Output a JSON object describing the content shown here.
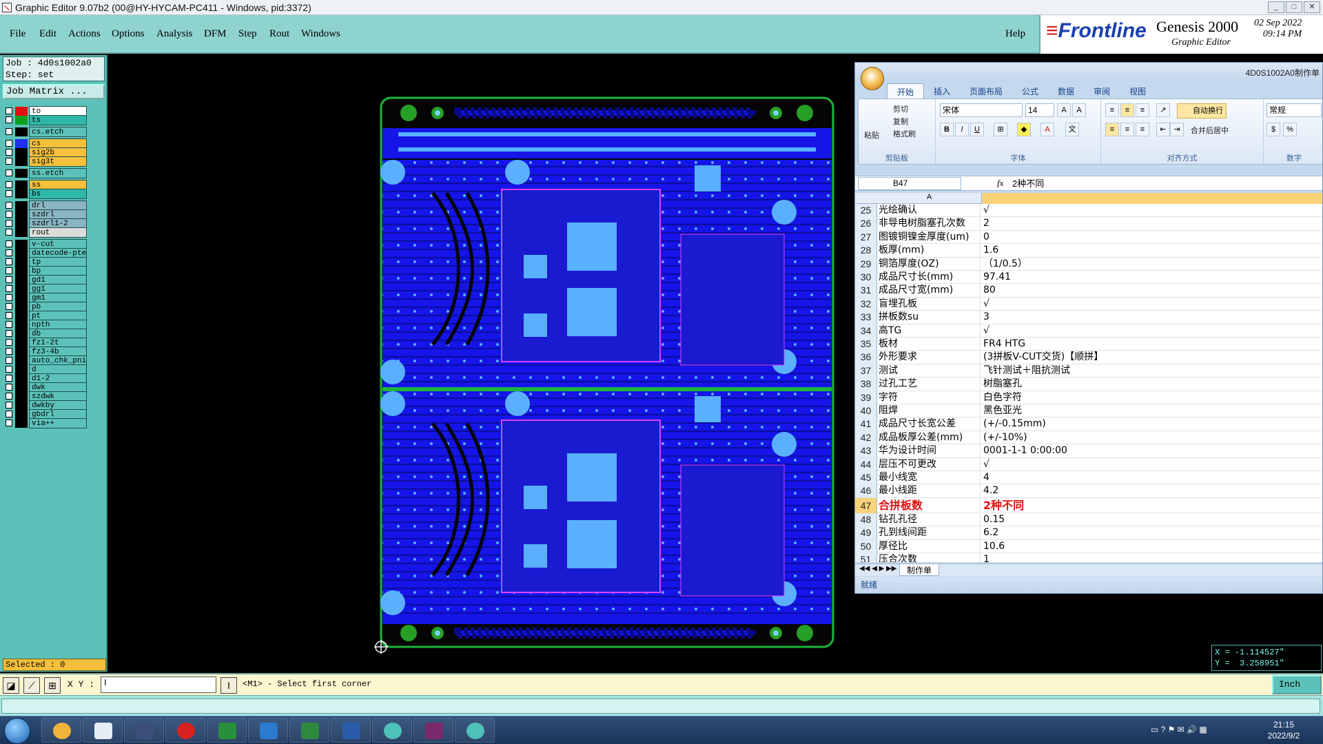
{
  "window": {
    "title": "Graphic Editor 9.07b2 (00@HY-HYCAM-PC411 - Windows, pid:3372)"
  },
  "menu": [
    "File",
    "Edit",
    "Actions",
    "Options",
    "Analysis",
    "DFM",
    "Step",
    "Rout",
    "Windows"
  ],
  "help_label": "Help",
  "brand": {
    "logo": "Frontline",
    "product": "Genesis 2000",
    "subtitle": "Graphic Editor",
    "date": "02 Sep 2022",
    "time": "09:14 PM"
  },
  "job": {
    "job_line": "Job : 4d0s1002a0",
    "step_line": "Step: set",
    "matrix_label": "Job Matrix ..."
  },
  "layers": [
    {
      "name": "to",
      "swatch": "#e41010",
      "bg": "#ffffff"
    },
    {
      "name": "ts",
      "swatch": "#10a020",
      "bg": "#2fb7a8"
    },
    {
      "name": "cs.etch",
      "swatch": "#000000",
      "bg": "#5cc2b9"
    },
    {
      "name": "cs",
      "swatch": "#2030f0",
      "bg": "#f6c03c"
    },
    {
      "name": "sig2b",
      "swatch": "#000000",
      "bg": "#f6c03c"
    },
    {
      "name": "sig3t",
      "swatch": "#000000",
      "bg": "#f6c03c"
    },
    {
      "name": "ss.etch",
      "swatch": "#000000",
      "bg": "#5cc2b9"
    },
    {
      "name": "ss",
      "swatch": "#000000",
      "bg": "#f6c03c"
    },
    {
      "name": "bs",
      "swatch": "#000000",
      "bg": "#2fb7a8"
    },
    {
      "name": "drl",
      "swatch": "#000000",
      "bg": "#8ab5c2"
    },
    {
      "name": "szdrl",
      "swatch": "#000000",
      "bg": "#8ab5c2"
    },
    {
      "name": "szdrl1-2",
      "swatch": "#000000",
      "bg": "#8ab5c2"
    },
    {
      "name": "rout",
      "swatch": "#000000",
      "bg": "#dcdcdc"
    },
    {
      "name": "v-cut",
      "swatch": "#000000",
      "bg": "#5cc2b9"
    },
    {
      "name": "datecode-pte",
      "swatch": "#000000",
      "bg": "#5cc2b9"
    },
    {
      "name": "tp",
      "swatch": "#000000",
      "bg": "#5cc2b9"
    },
    {
      "name": "bp",
      "swatch": "#000000",
      "bg": "#5cc2b9"
    },
    {
      "name": "gd1",
      "swatch": "#000000",
      "bg": "#5cc2b9"
    },
    {
      "name": "gg1",
      "swatch": "#000000",
      "bg": "#5cc2b9"
    },
    {
      "name": "gm1",
      "swatch": "#000000",
      "bg": "#5cc2b9"
    },
    {
      "name": "pb",
      "swatch": "#000000",
      "bg": "#5cc2b9"
    },
    {
      "name": "pt",
      "swatch": "#000000",
      "bg": "#5cc2b9"
    },
    {
      "name": "npth",
      "swatch": "#000000",
      "bg": "#5cc2b9"
    },
    {
      "name": "db",
      "swatch": "#000000",
      "bg": "#5cc2b9"
    },
    {
      "name": "fz1-2t",
      "swatch": "#000000",
      "bg": "#5cc2b9"
    },
    {
      "name": "fz3-4b",
      "swatch": "#000000",
      "bg": "#5cc2b9"
    },
    {
      "name": "auto_chk_pni",
      "swatch": "#000000",
      "bg": "#5cc2b9"
    },
    {
      "name": "d",
      "swatch": "#000000",
      "bg": "#5cc2b9"
    },
    {
      "name": "d1-2",
      "swatch": "#000000",
      "bg": "#5cc2b9"
    },
    {
      "name": "dwk",
      "swatch": "#000000",
      "bg": "#5cc2b9"
    },
    {
      "name": "szdwk",
      "swatch": "#000000",
      "bg": "#5cc2b9"
    },
    {
      "name": "dwkby",
      "swatch": "#000000",
      "bg": "#5cc2b9"
    },
    {
      "name": "gbdrl",
      "swatch": "#000000",
      "bg": "#5cc2b9"
    },
    {
      "name": "via++",
      "swatch": "#000000",
      "bg": "#5cc2b9"
    }
  ],
  "selected": "Selected : 0",
  "status": {
    "xy_label": "X Y :",
    "prompt": "<M1> - Select first corner",
    "units": "Inch",
    "x": "X = -1.114527\"",
    "y": "Y =  3.258951\""
  },
  "excel": {
    "window_title": "4D0S1002A0制作单",
    "tabs": [
      "开始",
      "插入",
      "页面布局",
      "公式",
      "数据",
      "审阅",
      "视图"
    ],
    "clipboard": {
      "paste": "粘贴",
      "cut": "剪切",
      "copy": "复制",
      "format": "格式刷",
      "group": "剪贴板"
    },
    "font": {
      "name": "宋体",
      "size": "14",
      "group": "字体"
    },
    "align": {
      "wrap": "自动换行",
      "merge": "合并后居中",
      "group": "对齐方式"
    },
    "number": {
      "format": "常规",
      "group": "数字"
    },
    "namebox": "B47",
    "formula": "2种不同",
    "col_a": "A",
    "rows": [
      {
        "n": "25",
        "a": "光绘确认",
        "b": "√"
      },
      {
        "n": "26",
        "a": "非导电树脂塞孔次数",
        "b": "2"
      },
      {
        "n": "27",
        "a": "图镀铜镍金厚度(um)",
        "b": "0"
      },
      {
        "n": "28",
        "a": "板厚(mm)",
        "b": "1.6"
      },
      {
        "n": "29",
        "a": "铜箔厚度(OZ)",
        "b": "（1/0.5）"
      },
      {
        "n": "30",
        "a": "成品尺寸长(mm)",
        "b": "97.41"
      },
      {
        "n": "31",
        "a": "成品尺寸宽(mm)",
        "b": "80"
      },
      {
        "n": "32",
        "a": "盲埋孔板",
        "b": "√"
      },
      {
        "n": "33",
        "a": "拼板数su",
        "b": "3"
      },
      {
        "n": "34",
        "a": "高TG",
        "b": "√"
      },
      {
        "n": "35",
        "a": "板材",
        "b": "FR4 HTG"
      },
      {
        "n": "36",
        "a": "外形要求",
        "b": "(3拼板V-CUT交货)【顺拼】"
      },
      {
        "n": "37",
        "a": "测试",
        "b": "飞针测试＋阻抗测试"
      },
      {
        "n": "38",
        "a": "过孔工艺",
        "b": "树脂塞孔"
      },
      {
        "n": "39",
        "a": "字符",
        "b": "白色字符"
      },
      {
        "n": "40",
        "a": "阻焊",
        "b": "黑色亚光"
      },
      {
        "n": "41",
        "a": "成品尺寸长宽公差",
        "b": "(+/-0.15mm)"
      },
      {
        "n": "42",
        "a": "成品板厚公差(mm)",
        "b": "(+/-10%)"
      },
      {
        "n": "43",
        "a": "华为设计时间",
        "b": "0001-1-1 0:00:00"
      },
      {
        "n": "44",
        "a": "层压不可更改",
        "b": "√"
      },
      {
        "n": "45",
        "a": "最小线宽",
        "b": "4"
      },
      {
        "n": "46",
        "a": "最小线距",
        "b": "4.2"
      },
      {
        "n": "47",
        "a": "合拼板数",
        "b": "2种不同",
        "hl": true
      },
      {
        "n": "48",
        "a": "钻孔孔径",
        "b": "0.15"
      },
      {
        "n": "49",
        "a": "孔到线间距",
        "b": "6.2"
      },
      {
        "n": "50",
        "a": "厚径比",
        "b": "10.6"
      },
      {
        "n": "51",
        "a": "压合次数",
        "b": "1"
      }
    ],
    "sheet": "制作单",
    "status": "就绪"
  },
  "taskbar": {
    "time": "21:15",
    "date": "2022/9/2"
  }
}
